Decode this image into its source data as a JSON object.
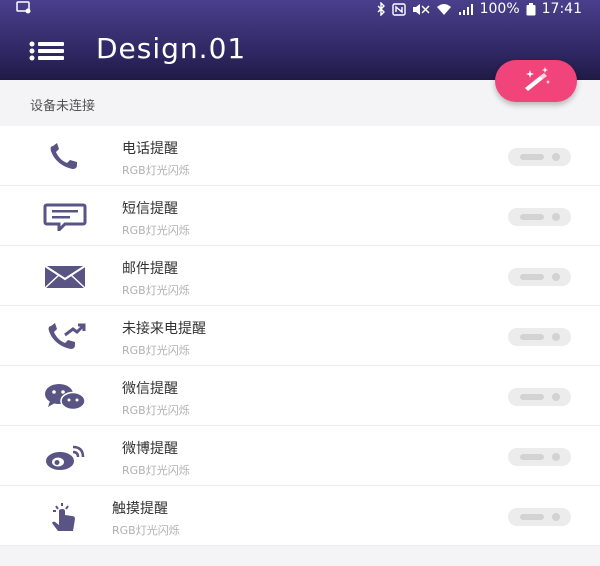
{
  "status_bar": {
    "battery": "100%",
    "time": "17:41"
  },
  "app": {
    "title": "Design.01",
    "accent_color": "#f0447a",
    "icon_color": "#5a5485"
  },
  "section": {
    "header": "设备未连接"
  },
  "items": [
    {
      "icon": "phone-icon",
      "title": "电话提醒",
      "subtitle": "RGB灯光闪烁",
      "enabled": false
    },
    {
      "icon": "sms-icon",
      "title": "短信提醒",
      "subtitle": "RGB灯光闪烁",
      "enabled": false
    },
    {
      "icon": "mail-icon",
      "title": "邮件提醒",
      "subtitle": "RGB灯光闪烁",
      "enabled": false
    },
    {
      "icon": "missed-call-icon",
      "title": "未接来电提醒",
      "subtitle": "RGB灯光闪烁",
      "enabled": false
    },
    {
      "icon": "wechat-icon",
      "title": "微信提醒",
      "subtitle": "RGB灯光闪烁",
      "enabled": false
    },
    {
      "icon": "weibo-icon",
      "title": "微博提醒",
      "subtitle": "RGB灯光闪烁",
      "enabled": false
    },
    {
      "icon": "touch-icon",
      "title": "触摸提醒",
      "subtitle": "RGB灯光闪烁",
      "enabled": false
    }
  ]
}
